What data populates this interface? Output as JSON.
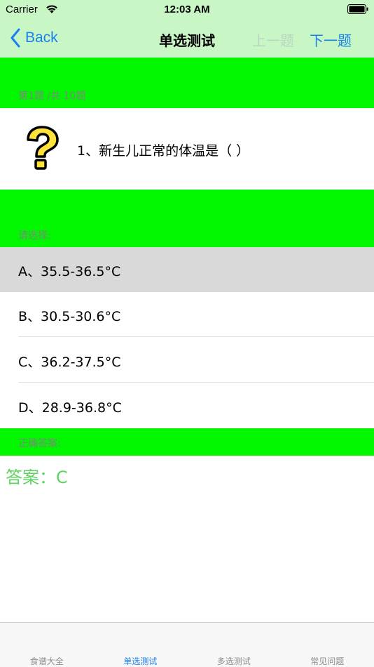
{
  "status_bar": {
    "carrier": "Carrier",
    "time": "12:03 AM"
  },
  "nav": {
    "back_label": "Back",
    "title": "单选测试",
    "prev_label": "上一题",
    "next_label": "下一题"
  },
  "progress": {
    "label": "第1题 /共 10题"
  },
  "question": {
    "text": "1、新生儿正常的体温是（  ）",
    "icon": "question-mark-icon"
  },
  "choose": {
    "label": "请选择:"
  },
  "options": [
    {
      "label": "A、35.5-36.5°C",
      "selected": true
    },
    {
      "label": "B、30.5-30.6°C",
      "selected": false
    },
    {
      "label": "C、36.2-37.5°C",
      "selected": false
    },
    {
      "label": "D、28.9-36.8°C",
      "selected": false
    }
  ],
  "correct": {
    "label": "正确答案:",
    "answer": "答案：C"
  },
  "tabs": [
    {
      "label": "食谱大全",
      "active": false
    },
    {
      "label": "单选测试",
      "active": true
    },
    {
      "label": "多选测试",
      "active": false
    },
    {
      "label": "常见问题",
      "active": false
    }
  ],
  "colors": {
    "nav_background": "#c8f7c5",
    "section_green": "#00f700",
    "accent_blue": "#1a7ff0",
    "answer_green": "#5fd35f",
    "selected_row": "#d9d9d9"
  }
}
